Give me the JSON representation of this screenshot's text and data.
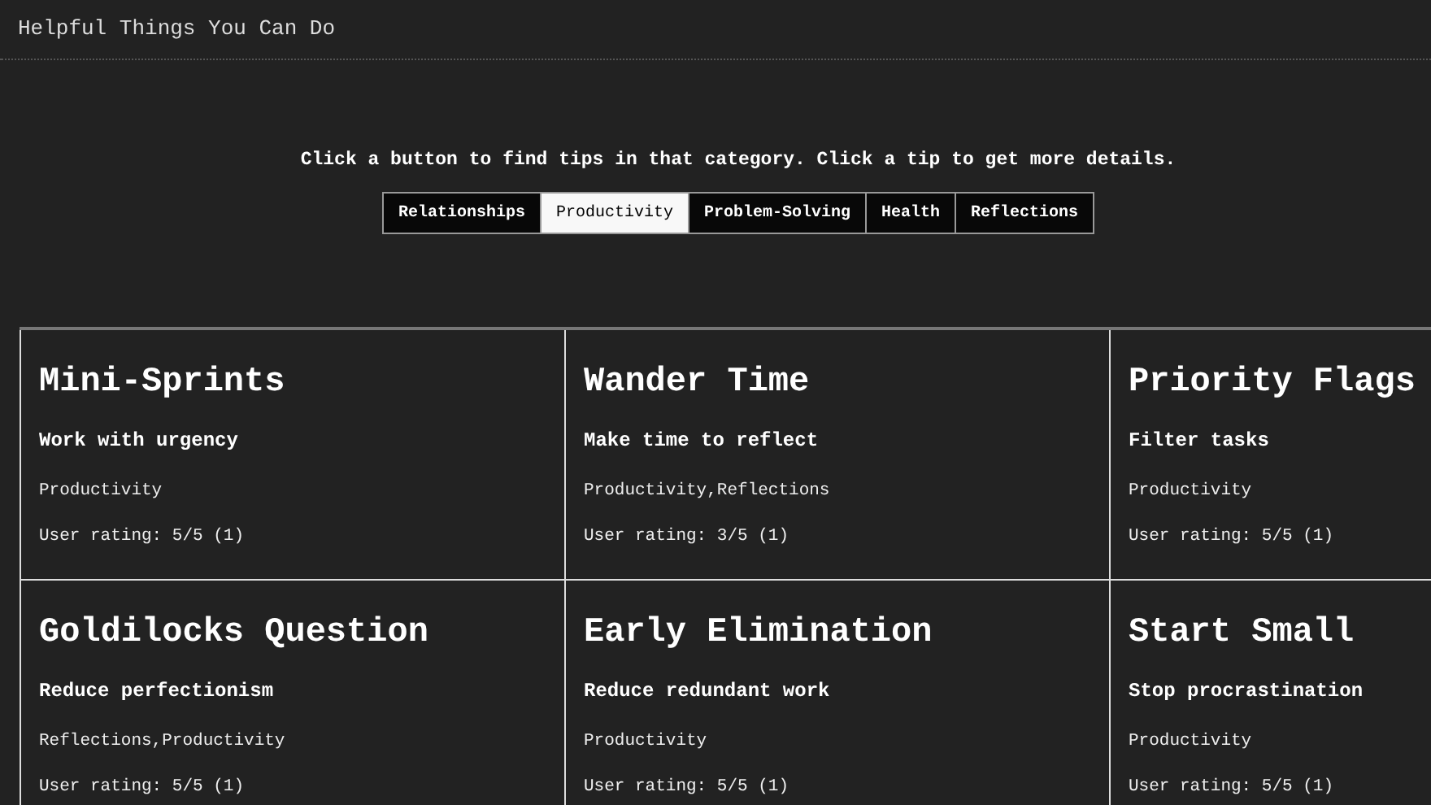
{
  "header": {
    "title": "Helpful Things You Can Do"
  },
  "instructions": "Click a button to find tips in that category. Click a tip to get more details.",
  "categories": [
    {
      "label": "Relationships",
      "selected": false
    },
    {
      "label": "Productivity",
      "selected": true
    },
    {
      "label": "Problem-Solving",
      "selected": false
    },
    {
      "label": "Health",
      "selected": false
    },
    {
      "label": "Reflections",
      "selected": false
    }
  ],
  "tips": [
    {
      "title": "Mini-Sprints",
      "subtitle": "Work with urgency",
      "tags": "Productivity",
      "rating": "User rating: 5/5 (1)"
    },
    {
      "title": "Wander Time",
      "subtitle": "Make time to reflect",
      "tags": "Productivity,Reflections",
      "rating": "User rating: 3/5 (1)"
    },
    {
      "title": "Priority Flags",
      "subtitle": "Filter tasks",
      "tags": "Productivity",
      "rating": "User rating: 5/5 (1)"
    },
    {
      "title": "Goldilocks Question",
      "subtitle": "Reduce perfectionism",
      "tags": "Reflections,Productivity",
      "rating": "User rating: 5/5 (1)"
    },
    {
      "title": "Early Elimination",
      "subtitle": "Reduce redundant work",
      "tags": "Productivity",
      "rating": "User rating: 5/5 (1)"
    },
    {
      "title": "Start Small",
      "subtitle": "Stop procrastination",
      "tags": "Productivity",
      "rating": "User rating: 5/5 (1)"
    }
  ]
}
